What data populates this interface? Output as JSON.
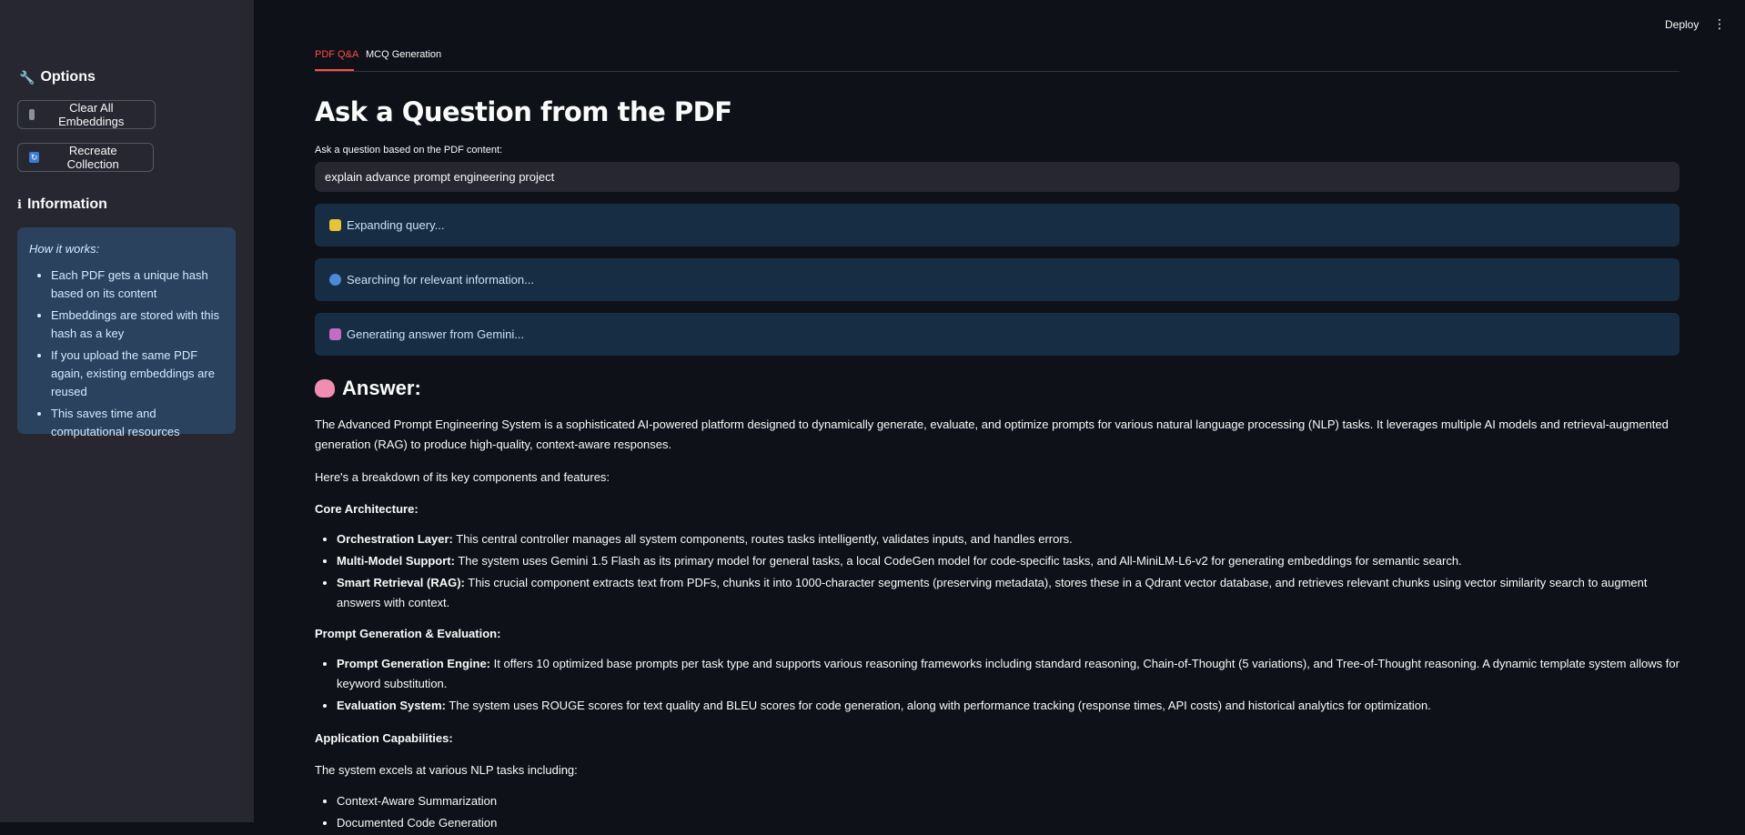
{
  "sidebar": {
    "options_heading": "Options",
    "clear_button": "Clear All Embeddings",
    "recreate_button": "Recreate Collection",
    "info_heading": "Information",
    "info_box": {
      "how": "How it works:",
      "items": [
        "Each PDF gets a unique hash based on its content",
        "Embeddings are stored with this hash as a key",
        "If you upload the same PDF again, existing embeddings are reused",
        "This saves time and computational resources"
      ]
    }
  },
  "header": {
    "deploy": "Deploy",
    "menu_icon": "⋮"
  },
  "tabs": [
    "PDF Q&A",
    "MCQ Generation"
  ],
  "main": {
    "title": "Ask a Question from the PDF",
    "question_label": "Ask a question based on the PDF content:",
    "question_value": "explain advance prompt engineering project",
    "status": [
      "Expanding query...",
      "Searching for relevant information...",
      "Generating answer from Gemini..."
    ],
    "answer_heading": "Answer:",
    "answer": {
      "intro": "The Advanced Prompt Engineering System is a sophisticated AI-powered platform designed to dynamically generate, evaluate, and optimize prompts for various natural language processing (NLP) tasks. It leverages multiple AI models and retrieval-augmented generation (RAG) to produce high-quality, context-aware responses.",
      "breakdown": "Here's a breakdown of its key components and features:",
      "section1": "Core Architecture:",
      "core": [
        {
          "b": "Orchestration Layer:",
          "t": " This central controller manages all system components, routes tasks intelligently, validates inputs, and handles errors."
        },
        {
          "b": "Multi-Model Support:",
          "t": " The system uses Gemini 1.5 Flash as its primary model for general tasks, a local CodeGen model for code-specific tasks, and All-MiniLM-L6-v2 for generating embeddings for semantic search."
        },
        {
          "b": "Smart Retrieval (RAG):",
          "t": " This crucial component extracts text from PDFs, chunks it into 1000-character segments (preserving metadata), stores these in a Qdrant vector database, and retrieves relevant chunks using vector similarity search to augment answers with context."
        }
      ],
      "section2": "Prompt Generation & Evaluation:",
      "gen": [
        {
          "b": "Prompt Generation Engine:",
          "t": " It offers 10 optimized base prompts per task type and supports various reasoning frameworks including standard reasoning, Chain-of-Thought (5 variations), and Tree-of-Thought reasoning. A dynamic template system allows for keyword substitution."
        },
        {
          "b": "Evaluation System:",
          "t": " The system uses ROUGE scores for text quality and BLEU scores for code generation, along with performance tracking (response times, API costs) and historical analytics for optimization."
        }
      ],
      "section3": "Application Capabilities:",
      "capabilities_intro": "The system excels at various NLP tasks including:",
      "capabilities": [
        "Context-Aware Summarization",
        "Documented Code Generation"
      ]
    }
  }
}
